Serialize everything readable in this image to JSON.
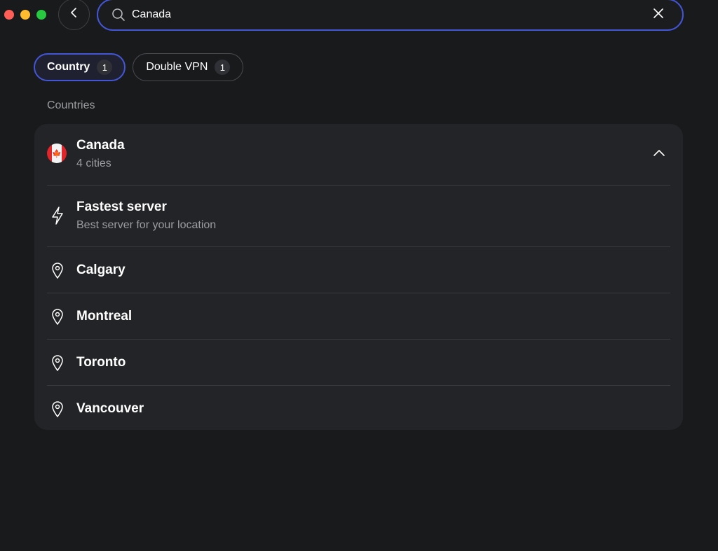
{
  "window": {
    "buttons": [
      "close",
      "minimize",
      "maximize"
    ]
  },
  "search": {
    "value": "Canada",
    "placeholder": ""
  },
  "filters": [
    {
      "label": "Country",
      "count": "1",
      "active": true
    },
    {
      "label": "Double VPN",
      "count": "1",
      "active": false
    }
  ],
  "section": {
    "title": "Countries"
  },
  "country": {
    "name": "Canada",
    "subtitle": "4 cities",
    "icon": "canada-flag"
  },
  "fastest": {
    "title": "Fastest server",
    "subtitle": "Best server for your location",
    "icon": "lightning-icon"
  },
  "cities": [
    "Calgary",
    "Montreal",
    "Toronto",
    "Vancouver"
  ],
  "colors": {
    "accent": "#4456d8",
    "background": "#191a1c",
    "card": "#232427",
    "muted_text": "#9c9da1"
  }
}
